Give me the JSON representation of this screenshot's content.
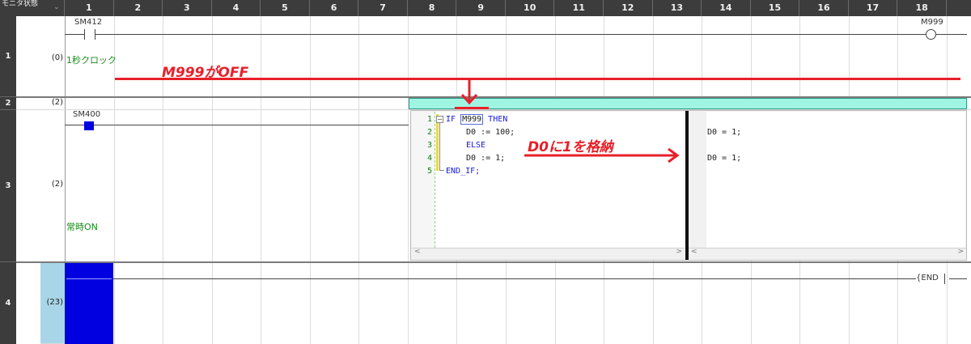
{
  "header": {
    "corner_label": "モニタ状態",
    "chevron_icon": "chevron-down-icon",
    "columns": [
      "1",
      "2",
      "3",
      "4",
      "5",
      "6",
      "7",
      "8",
      "9",
      "10",
      "11",
      "12",
      "13",
      "14",
      "15",
      "16",
      "17",
      "18"
    ]
  },
  "rows": [
    {
      "number": "1",
      "step": "(0)"
    },
    {
      "number": "2",
      "step": "(2)"
    },
    {
      "number": "3",
      "step": "(2)"
    },
    {
      "number": "4",
      "step": "(23)"
    }
  ],
  "ladder": {
    "contact_1": "SM412",
    "comment_1": "1秒クロック",
    "coil_1": "M999",
    "contact_2": "SM400",
    "comment_2": "常時ON",
    "end_label": "END"
  },
  "st_editor": {
    "line_numbers": [
      "1",
      "2",
      "3",
      "4",
      "5"
    ],
    "lines": [
      {
        "pre": "IF ",
        "var": "M999",
        "post": " THEN"
      },
      {
        "text": "D0 := 100;"
      },
      {
        "text": "ELSE"
      },
      {
        "text": "D0 := 1;"
      },
      {
        "text": "END_IF;"
      }
    ],
    "monitor": [
      "D0 = 1;",
      "D0 = 1;"
    ],
    "scroll_left": "<",
    "scroll_right": ">"
  },
  "annotations": {
    "m999_off": "M999がOFF",
    "d0_store": "D0に1を格納"
  },
  "colors": {
    "accent_red": "#e8202a",
    "header_dark": "#3c3c3c",
    "fb_cyan": "#9ff5e2",
    "row_highlight": "#a8d6e8",
    "cursor_blue": "#0000e0",
    "comment_green": "#1a8a1a",
    "keyword_blue": "#1a1ad8"
  }
}
